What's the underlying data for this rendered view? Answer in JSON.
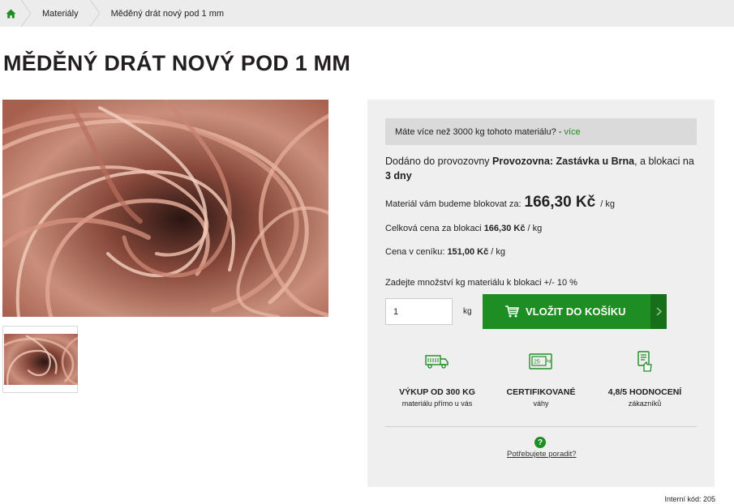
{
  "breadcrumb": {
    "home_icon": "home-icon",
    "items": [
      "Materiály",
      "Měděný drát nový pod 1 mm"
    ]
  },
  "title": "MĚDĚNÝ DRÁT NOVÝ POD 1 MM",
  "panel": {
    "notice_text": "Máte více než 3000 kg tohoto materiálu? -",
    "notice_link": "více",
    "delivery_prefix": "Dodáno do provozovny",
    "delivery_place": "Provozovna: Zastávka u Brna",
    "delivery_mid": ", a blokaci na",
    "delivery_days": "3 dny",
    "block_label": "Materiál vám budeme blokovat za:",
    "block_price": "166,30 Kč",
    "block_unit": "/ kg",
    "total_label": "Celková cena za blokaci",
    "total_value": "166,30 Kč",
    "total_unit": "/ kg",
    "list_label": "Cena v ceníku:",
    "list_value": "151,00 Kč",
    "list_unit": "/ kg",
    "qty_label": "Zadejte množství kg materiálu k blokaci +/- 10 %",
    "qty_value": "1",
    "qty_unit": "kg",
    "cart_button": "VLOŽIT DO KOŠÍKU",
    "features": [
      {
        "icon": "truck-icon",
        "title": "VÝKUP OD 300 KG",
        "sub": "materiálu přímo u vás"
      },
      {
        "icon": "scale-icon",
        "title": "CERTIFIKOVANÉ",
        "sub": "váhy"
      },
      {
        "icon": "rating-icon",
        "title": "4,8/5 HODNOCENÍ",
        "sub": "zákazníků"
      }
    ],
    "help_icon": "?",
    "help_link": "Potřebujete poradit?"
  },
  "internal_code": "Interní kód: 205",
  "colors": {
    "accent": "#1e8e24",
    "accent_dark": "#177019",
    "panel_bg": "#efefef"
  }
}
